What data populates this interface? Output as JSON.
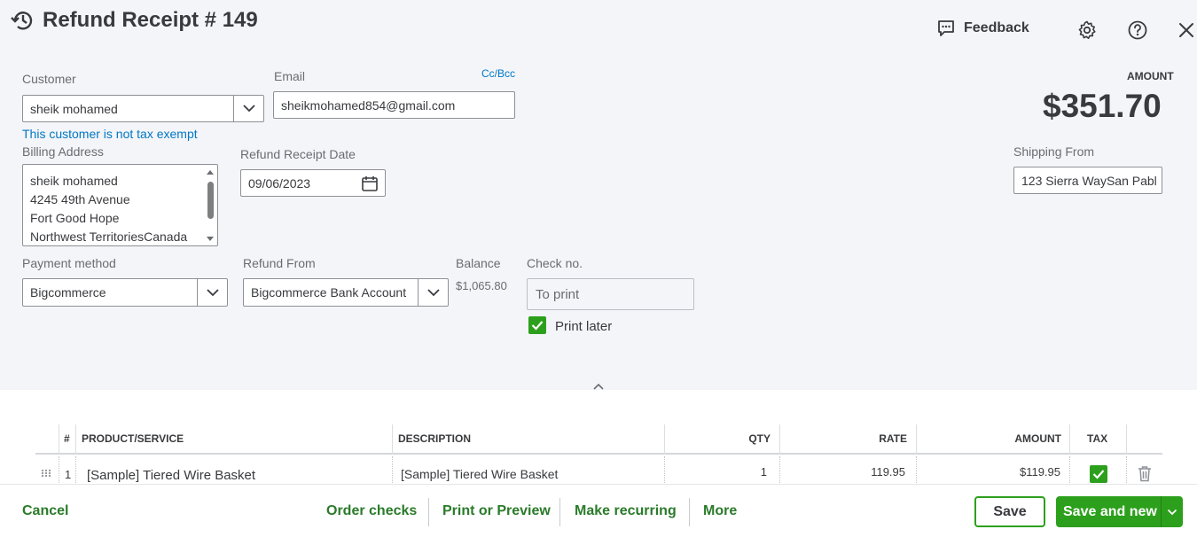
{
  "header": {
    "title": "Refund Receipt # 149",
    "feedback_label": "Feedback"
  },
  "form": {
    "customer": {
      "label": "Customer",
      "value": "sheik mohamed",
      "note": "This customer is not tax exempt"
    },
    "email": {
      "label": "Email",
      "value": "sheikmohamed854@gmail.com",
      "cc_bcc": "Cc/Bcc"
    },
    "billing_address": {
      "label": "Billing Address",
      "lines": [
        "sheik mohamed",
        "4245 49th Avenue",
        "Fort Good Hope",
        "Northwest TerritoriesCanada"
      ]
    },
    "refund_date": {
      "label": "Refund Receipt Date",
      "value": "09/06/2023"
    },
    "payment_method": {
      "label": "Payment method",
      "value": "Bigcommerce"
    },
    "refund_from": {
      "label": "Refund From",
      "value": "Bigcommerce Bank Account"
    },
    "balance": {
      "label": "Balance",
      "value": "$1,065.80"
    },
    "check_no": {
      "label": "Check no.",
      "value": "To print"
    },
    "print_later": {
      "label": "Print later",
      "checked": true
    },
    "amount": {
      "label": "AMOUNT",
      "value": "$351.70"
    },
    "shipping_from": {
      "label": "Shipping From",
      "value": "123 Sierra WaySan Pabl"
    }
  },
  "table": {
    "columns": [
      "#",
      "PRODUCT/SERVICE",
      "DESCRIPTION",
      "QTY",
      "RATE",
      "AMOUNT",
      "TAX"
    ],
    "rows": [
      {
        "num": "1",
        "product": "[Sample] Tiered Wire Basket",
        "description": "[Sample] Tiered Wire Basket",
        "qty": "1",
        "rate": "119.95",
        "amount": "$119.95",
        "tax": true
      }
    ]
  },
  "footer": {
    "cancel": "Cancel",
    "order_checks": "Order checks",
    "print_preview": "Print or Preview",
    "make_recurring": "Make recurring",
    "more": "More",
    "save": "Save",
    "save_and_new": "Save and new"
  },
  "colors": {
    "accent_green": "#2ca01c",
    "link_blue": "#0077c5",
    "panel_bg": "#f4f5f8"
  }
}
